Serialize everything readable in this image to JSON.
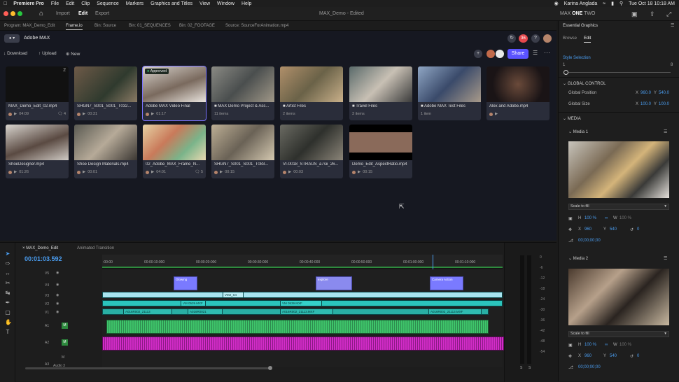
{
  "menubar": {
    "items": [
      "Premiere Pro",
      "File",
      "Edit",
      "Clip",
      "Sequence",
      "Markers",
      "Graphics and Titles",
      "View",
      "Window",
      "Help"
    ],
    "user": "Karina Anglada",
    "datetime": "Tue Oct 18  10:18 AM"
  },
  "apphdr": {
    "tabs": [
      "Import",
      "Edit",
      "Export"
    ],
    "active_tab": "Edit",
    "doc_title": "MAX_Demo - Edited",
    "workspace_prefix": "MAX",
    "workspace_active": "ONE",
    "workspace_suffix": "TWO"
  },
  "panel_tabs": [
    "Program: MAX_Demo_Edit",
    "Frame.io",
    "Bin: Source",
    "Bin: 01_SEQUENCES",
    "Bin: 02_FOOTAGE",
    "Source: SourceForAnimation.mp4"
  ],
  "frameio": {
    "project": "Adobe MAX",
    "badge": "36",
    "download": "Download",
    "upload": "Upload",
    "new": "New",
    "share": "Share",
    "cards": [
      {
        "title": "MAX_Demo_Edit_02.mp4",
        "time": "04:09",
        "count": "4",
        "corner": "2"
      },
      {
        "title": "SHGN7_S001_S001_T032...",
        "time": "00:31",
        "count": ""
      },
      {
        "title": "Adobe MAX Video Final",
        "time": "01:17",
        "count": "",
        "badge": "Approved"
      },
      {
        "title": "MAX Demo Project & Ass...",
        "time": "11 items",
        "count": ""
      },
      {
        "title": "Artist Files",
        "time": "2 items",
        "count": ""
      },
      {
        "title": "Travel Files",
        "time": "3 items",
        "count": ""
      },
      {
        "title": "Adobe MAX Test Files",
        "time": "1 item",
        "count": ""
      },
      {
        "title": "Alex and Adobe.mp4",
        "time": "",
        "count": ""
      },
      {
        "title": "ShoeDesigner.mp4",
        "time": "01:26",
        "count": ""
      },
      {
        "title": "Shoe Design Materials.mp4",
        "time": "00:01",
        "count": ""
      },
      {
        "title": "02_Adobe_MAX_Frame_N...",
        "time": "04:01",
        "count": "5"
      },
      {
        "title": "SHGN7_S001_S001_T083...",
        "time": "00:15",
        "count": ""
      },
      {
        "title": "VI-0018_STRAUS_a7sii_26...",
        "time": "00:03",
        "count": ""
      },
      {
        "title": "Demo_Edit_AspectRatio.mp4",
        "time": "00:15",
        "count": ""
      }
    ]
  },
  "eg": {
    "title": "Essential Graphics",
    "tabs": [
      "Browse",
      "Edit"
    ],
    "style_selection": "Style Selection",
    "style_min": "1",
    "style_max": "8",
    "global_control": "GLOBAL CONTROL",
    "global_position": "Global Position",
    "pos_x_label": "X",
    "pos_x": "960.0",
    "pos_y_label": "Y",
    "pos_y": "540.0",
    "global_size": "Global Size",
    "size_x_label": "X",
    "size_x": "100.0",
    "size_y_label": "Y",
    "size_y": "100.0",
    "media": "MEDIA",
    "media1": "Media 1",
    "media2": "Media 2",
    "scale": "Scale to fill",
    "h_label": "H",
    "h": "100 %",
    "w_label": "W",
    "w": "100 %",
    "x_label": "X",
    "x": "960",
    "y_label": "Y",
    "y": "540",
    "rot": "0",
    "tc": "00;00;00;00"
  },
  "timeline": {
    "seq_tab": "MAX_Demo_Edit",
    "anim_tab": "Animated Transition",
    "timecode": "00:01:03.592",
    "ruler": [
      ":00:00",
      "00:00:10:000",
      "00:00:20:000",
      "00:00:30:000",
      "00:00:40:000",
      "00:00:50:000",
      "00:01:00:000",
      "00:01:10:000"
    ],
    "tracks": [
      "V5",
      "V4",
      "V3",
      "V2",
      "V1",
      "A1",
      "A2",
      "M",
      "A3"
    ],
    "audio3": "Audio 3",
    "clip_labels": [
      "Glowing",
      "explore",
      "Camera Action",
      "VMJ_S4",
      "VM 0539.MXF",
      "A016R002_21113",
      "A016R0021",
      "A016R002_21113.MXF"
    ],
    "meter_ticks": [
      "0",
      "-6",
      "-12",
      "-18",
      "-24",
      "-30",
      "-36",
      "-42",
      "-48",
      "-54"
    ],
    "meter_bottom": [
      "S",
      "S"
    ]
  }
}
